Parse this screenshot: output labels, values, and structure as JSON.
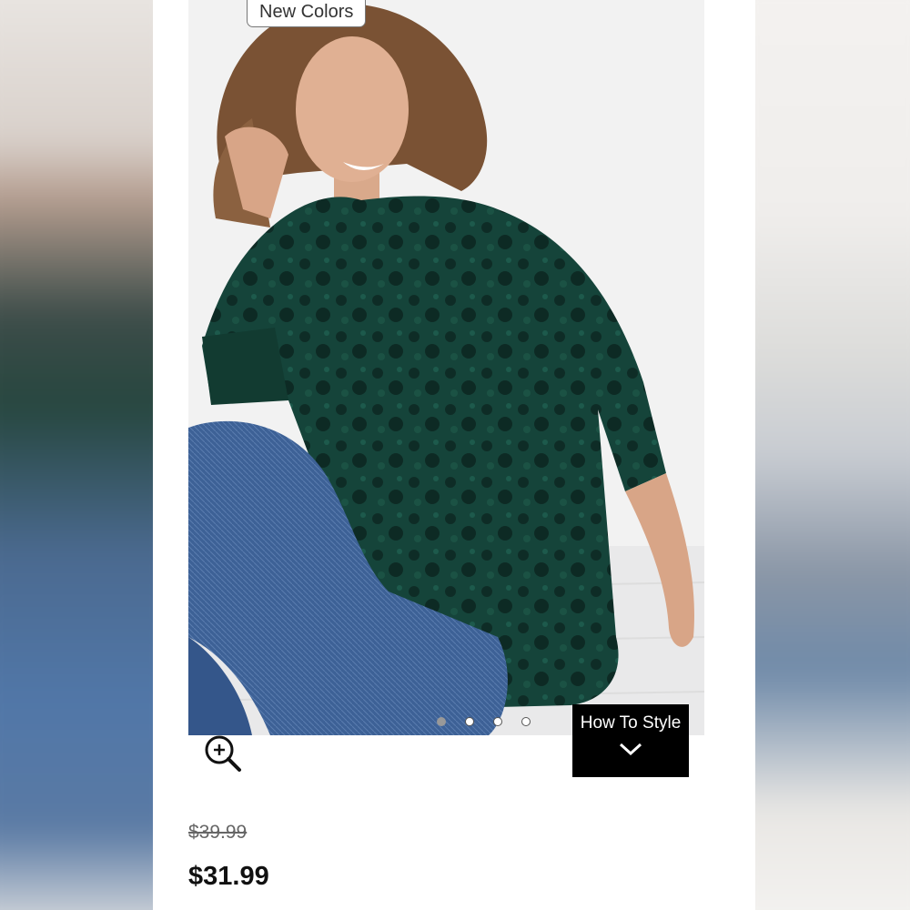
{
  "product": {
    "badge": "New Colors",
    "image_alt": "Woman wearing green velour tunic",
    "carousel": {
      "count": 4,
      "active_index": 0
    },
    "how_to_style": "How To Style",
    "price_original": "$39.99",
    "price_sale": "$31.99"
  },
  "icons": {
    "zoom": "zoom-in-icon",
    "chevron": "chevron-down-icon"
  },
  "colors": {
    "tunic": "#163f36",
    "jeans": "#3b5f91",
    "button_bg": "#000000"
  }
}
